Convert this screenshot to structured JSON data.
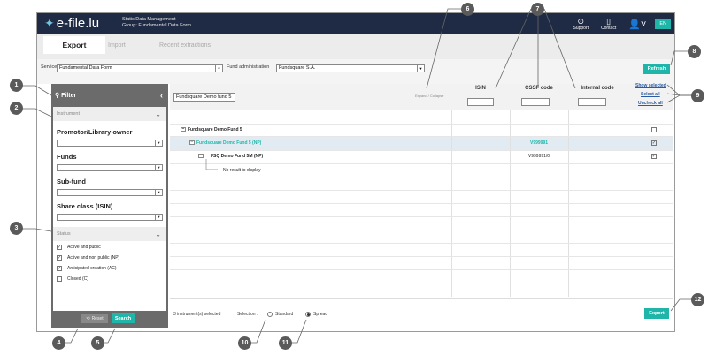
{
  "header": {
    "logo_text": "e-file.lu",
    "subtitle_line1": "Static Data Management",
    "subtitle_line2": "Group: Fundamental Data Form",
    "support_label": "Support",
    "contact_label": "Contact",
    "language": "EN"
  },
  "tabs": [
    {
      "label": "Export"
    },
    {
      "label": "Import"
    },
    {
      "label": "Recent extractions"
    }
  ],
  "service_row": {
    "service_label": "Service:",
    "service_value": "Fundamental Data Form",
    "fund_admin_label": "Fund administration",
    "fund_admin_value": "Fundsquare S.A.",
    "refresh_label": "Refresh"
  },
  "filter": {
    "title": "Filter",
    "instrument_section": "Instrument",
    "promotor_label": "Promotor/Library owner",
    "funds_label": "Funds",
    "subfund_label": "Sub-fund",
    "shareclass_label": "Share class (ISIN)",
    "status_section": "Status",
    "statuses": [
      {
        "label": "Active and public",
        "checked": true
      },
      {
        "label": "Active and non public (NP)",
        "checked": true
      },
      {
        "label": "Anticipated creation (AC)",
        "checked": true
      },
      {
        "label": "Closed (C)",
        "checked": false
      }
    ],
    "reset_label": "Reset",
    "search_label": "Search"
  },
  "grid": {
    "search_value": "Fundsquare Demo fund 5",
    "expand_collapse": "Expand / Collapse",
    "columns": [
      "ISIN",
      "CSSF code",
      "Internal code"
    ],
    "show_selected": "Show selected",
    "select_all": "Select all",
    "uncheck_all": "Uncheck all",
    "rows": [
      {
        "name": "Fundsquare Demo Fund 5",
        "cssf": "",
        "checked": false
      },
      {
        "name": "Fundsquare Demo Fund 5 (NP)",
        "cssf": "V999991",
        "checked": true
      },
      {
        "name": "FSQ Demo Fund 5M (NP)",
        "cssf": "V999991/0",
        "checked": true
      },
      {
        "name": "No result to display",
        "cssf": "",
        "checked": null
      }
    ]
  },
  "footer": {
    "selected_count": "3 instrument(s) selected",
    "selection_label": "Selection :",
    "standard_label": "Standard",
    "spread_label": "Spread",
    "export_label": "Export"
  },
  "callouts": [
    "1",
    "2",
    "3",
    "4",
    "5",
    "6",
    "7",
    "8",
    "9",
    "10",
    "11",
    "12"
  ],
  "colors": {
    "accent": "#1fb5a8",
    "topbar": "#1f2a44",
    "highlight_text": "#1fb5a8",
    "link": "#2c5aa0"
  }
}
